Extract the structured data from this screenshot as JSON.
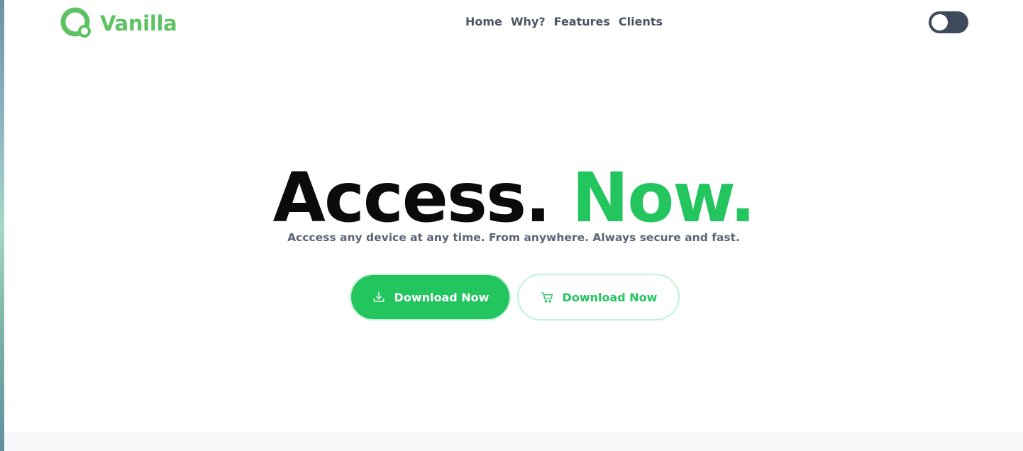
{
  "brand": {
    "name": "Vanilla",
    "color": "#5dc262"
  },
  "nav": {
    "items": [
      "Home",
      "Why?",
      "Features",
      "Clients"
    ]
  },
  "theme_toggle": {
    "state": "off"
  },
  "hero": {
    "title_part1": "Access.",
    "title_part2": "Now.",
    "subtitle": "Acccess any device at any time. From anywhere. Always secure and fast."
  },
  "buttons": {
    "primary_label": "Download Now",
    "primary_icon": "download-icon",
    "secondary_label": "Download Now",
    "secondary_icon": "cart-icon"
  },
  "colors": {
    "accent": "#22c55e",
    "text_dark": "#0b0b0b",
    "text_muted": "#5b6476",
    "toggle_bg": "#3f4a5a"
  }
}
